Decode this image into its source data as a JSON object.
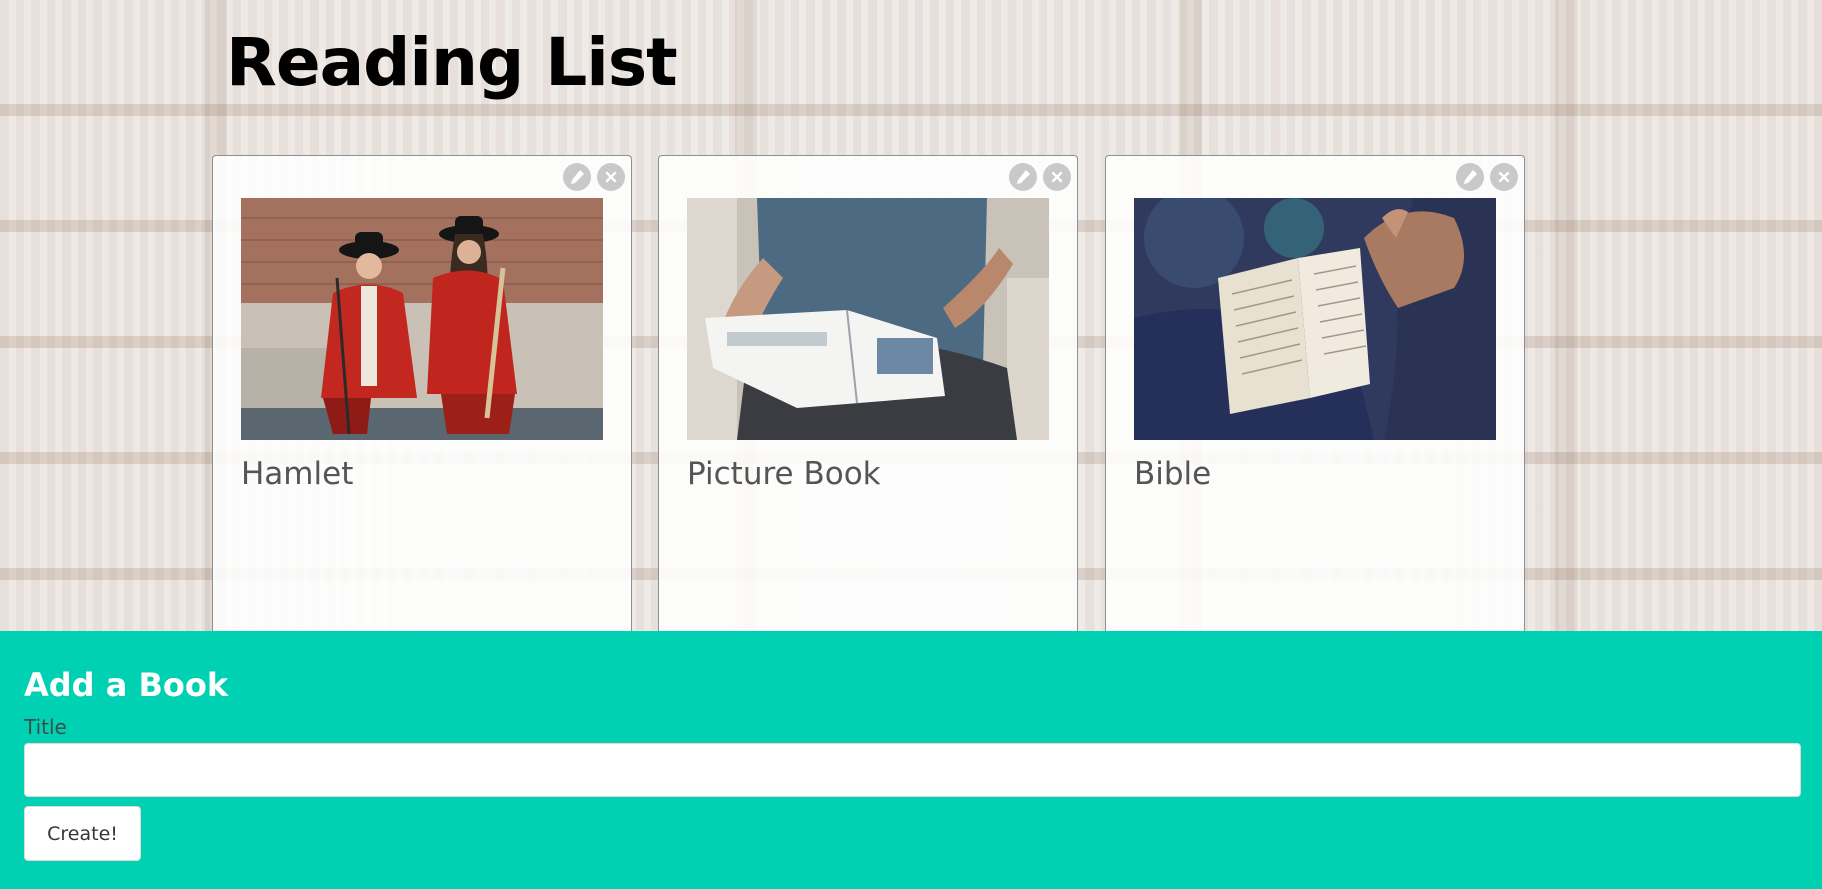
{
  "page": {
    "title": "Reading List"
  },
  "books": [
    {
      "title": "Hamlet",
      "image": "hamlet-actors-photo"
    },
    {
      "title": "Picture Book",
      "image": "person-reading-picture-book-photo"
    },
    {
      "title": "Bible",
      "image": "hands-holding-bible-photo"
    }
  ],
  "card_actions": {
    "edit_icon": "pencil-icon",
    "delete_icon": "close-icon"
  },
  "add_form": {
    "heading": "Add a Book",
    "title_label": "Title",
    "title_value": "",
    "title_placeholder": "",
    "create_label": "Create!"
  },
  "colors": {
    "panel": "#00d1b2",
    "card_border": "#8f8f8f",
    "action_button": "#c9c9c9"
  }
}
